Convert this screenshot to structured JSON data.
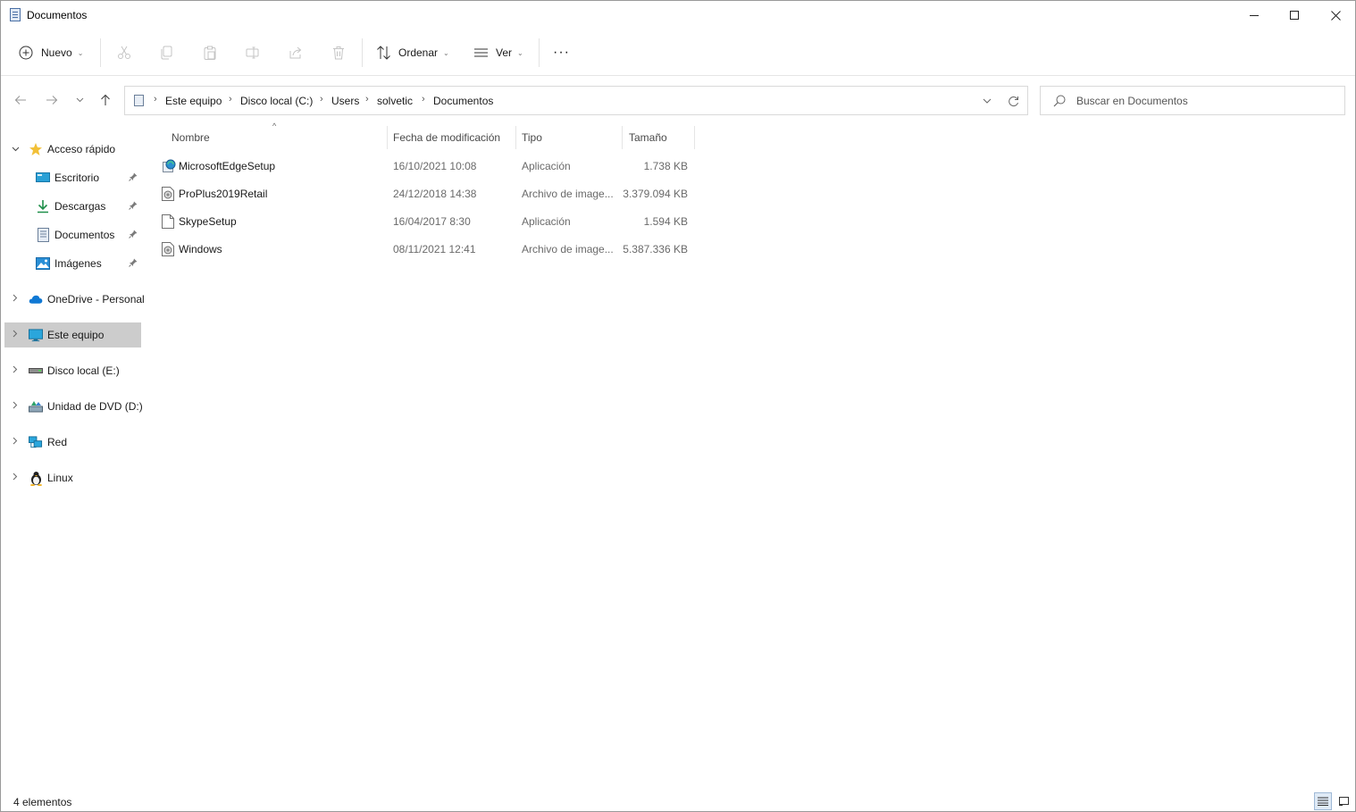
{
  "window": {
    "title": "Documentos",
    "minimize_label": "–",
    "maximize_label": "□",
    "close_label": "✕"
  },
  "toolbar": {
    "new_label": "Nuevo",
    "sort_label": "Ordenar",
    "view_label": "Ver",
    "more_label": "···",
    "disabled_icons": [
      "cut-icon",
      "copy-icon",
      "paste-icon",
      "rename-icon",
      "share-icon",
      "delete-icon"
    ]
  },
  "address": {
    "breadcrumbs": [
      "Este equipo",
      "Disco local (C:)",
      "Users",
      "solvetic",
      "Documentos"
    ]
  },
  "search": {
    "placeholder": "Buscar en Documentos"
  },
  "sidebar": {
    "items": [
      {
        "label": "Acceso rápido",
        "icon": "star-icon",
        "expanded": true
      },
      {
        "label": "Escritorio",
        "icon": "desktop-icon",
        "pinned": true
      },
      {
        "label": "Descargas",
        "icon": "download-icon",
        "pinned": true
      },
      {
        "label": "Documentos",
        "icon": "document-icon",
        "pinned": true
      },
      {
        "label": "Imágenes",
        "icon": "pictures-icon",
        "pinned": true
      },
      {
        "label": "OneDrive - Personal",
        "icon": "cloud-icon"
      },
      {
        "label": "Este equipo",
        "icon": "computer-icon",
        "selected": true
      },
      {
        "label": "Disco local (E:)",
        "icon": "drive-icon"
      },
      {
        "label": "Unidad de DVD (D:)",
        "icon": "dvd-icon"
      },
      {
        "label": "Red",
        "icon": "network-icon"
      },
      {
        "label": "Linux",
        "icon": "linux-icon"
      }
    ]
  },
  "files": {
    "columns": [
      "Nombre",
      "Fecha de modificación",
      "Tipo",
      "Tamaño"
    ],
    "rows": [
      {
        "name": "MicrosoftEdgeSetup",
        "date": "16/10/2021 10:08",
        "type": "Aplicación",
        "size": "1.738 KB",
        "icon": "installer-icon"
      },
      {
        "name": "ProPlus2019Retail",
        "date": "24/12/2018 14:38",
        "type": "Archivo de image...",
        "size": "3.379.094 KB",
        "icon": "disc-image-icon"
      },
      {
        "name": "SkypeSetup",
        "date": "16/04/2017 8:30",
        "type": "Aplicación",
        "size": "1.594 KB",
        "icon": "blank-file-icon"
      },
      {
        "name": "Windows",
        "date": "08/11/2021 12:41",
        "type": "Archivo de image...",
        "size": "5.387.336 KB",
        "icon": "disc-image-icon"
      }
    ]
  },
  "status": {
    "count": "4 elementos"
  },
  "colors": {
    "selection": "#cccccc",
    "accent": "#0078d4",
    "star": "#f2c037"
  }
}
